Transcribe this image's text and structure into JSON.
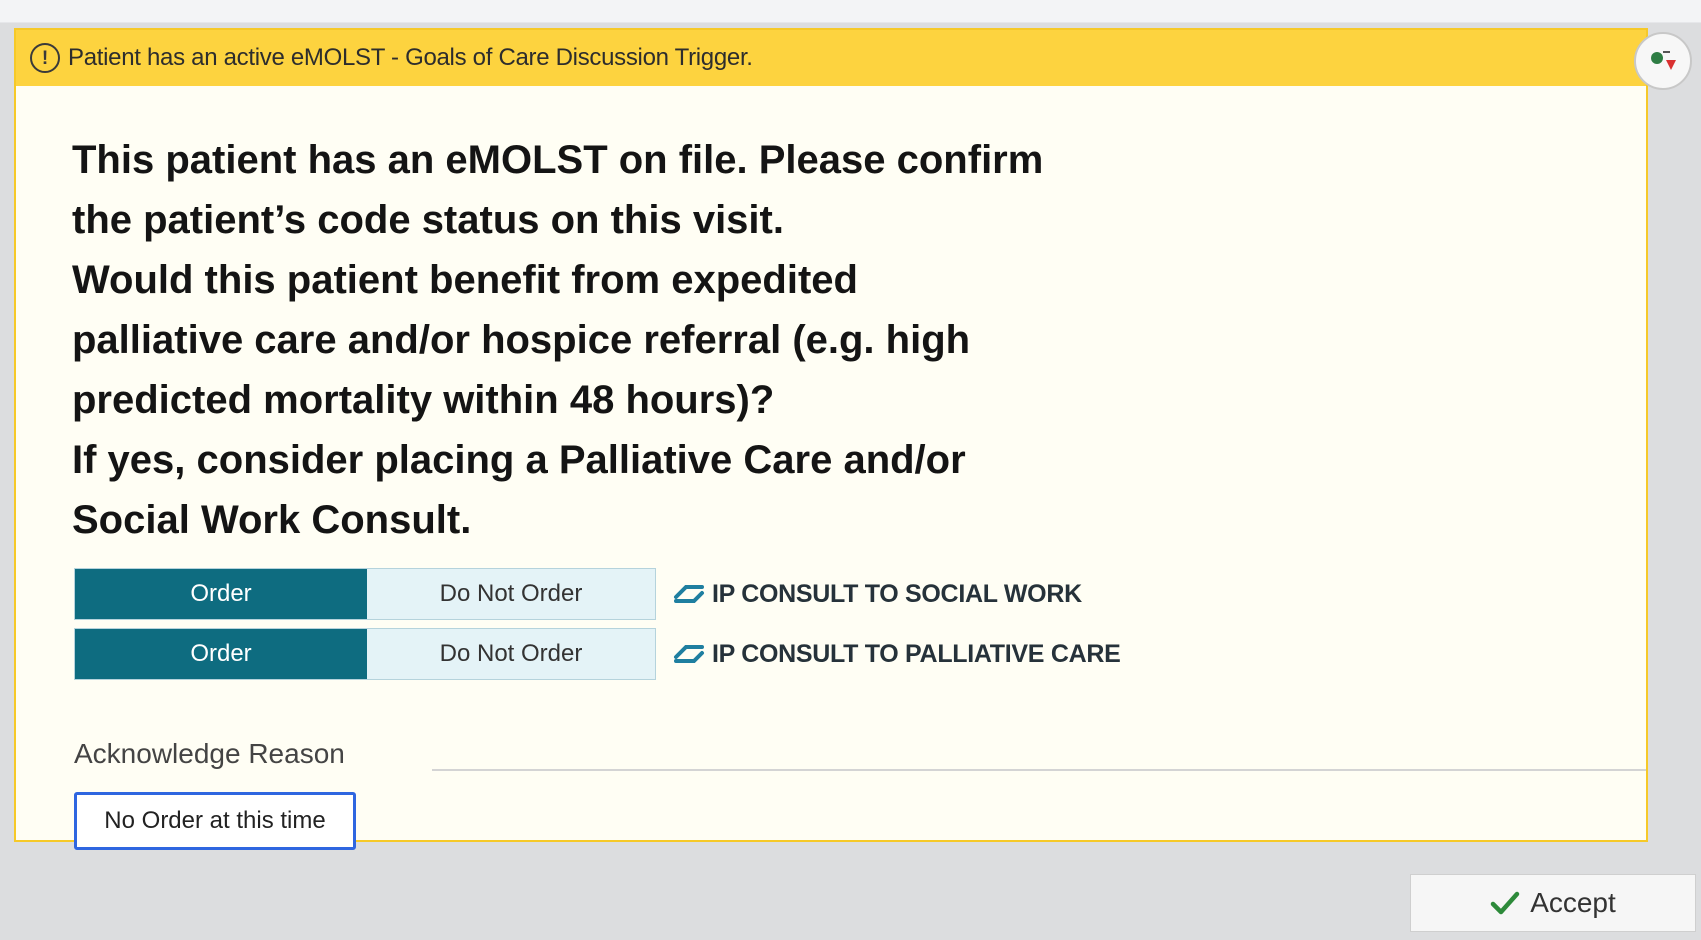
{
  "alert": {
    "header_title": "Patient has an active eMOLST - Goals of Care Discussion Trigger.",
    "message_lines": [
      "This patient has an eMOLST on file. Please confirm",
      "the patient’s code status on this visit.",
      "Would this patient benefit from expedited",
      "palliative care and/or hospice referral (e.g. high",
      "predicted mortality within 48 hours)?",
      "If yes, consider placing a Palliative Care and/or",
      "Social Work Consult."
    ]
  },
  "orders": [
    {
      "order_label": "Order",
      "do_not_order_label": "Do Not Order",
      "name": "IP CONSULT TO SOCIAL WORK",
      "selected": "Order"
    },
    {
      "order_label": "Order",
      "do_not_order_label": "Do Not Order",
      "name": "IP CONSULT TO PALLIATIVE CARE",
      "selected": "Order"
    }
  ],
  "acknowledge": {
    "label": "Acknowledge Reason",
    "reasons": [
      "No Order at this time"
    ]
  },
  "footer": {
    "accept_label": "Accept"
  },
  "icons": {
    "header": "warning-circle-icon",
    "corner": "smart-tools-icon",
    "order": "order-link-icon",
    "accept": "checkmark-icon"
  },
  "colors": {
    "header_bg": "#fdd33f",
    "card_bg": "#fffef4",
    "order_selected": "#0e6c80",
    "do_not_order_bg": "#e4f3f7",
    "reason_border": "#2f66e0",
    "accept_check": "#2d8a3a"
  }
}
